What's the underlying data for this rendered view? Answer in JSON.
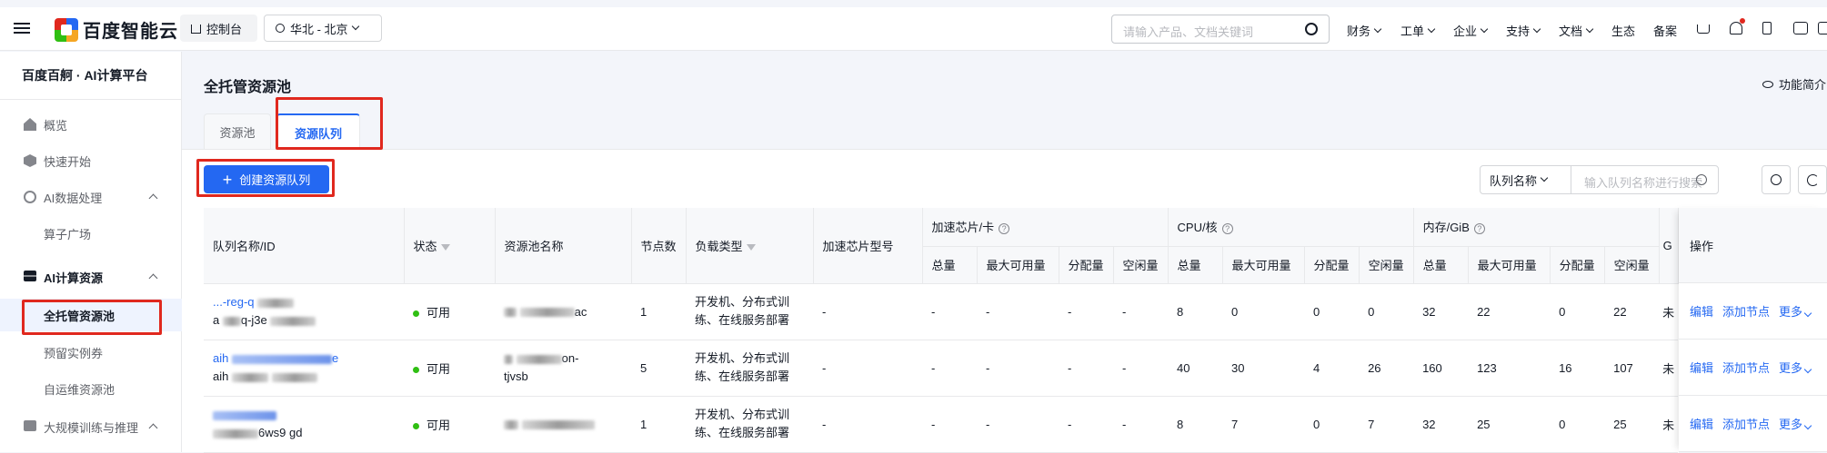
{
  "topbar": {
    "brand": "百度智能云",
    "console": "控制台",
    "region": "华北 - 北京",
    "search_placeholder": "请输入产品、文档关键词",
    "nav": [
      "财务",
      "工单",
      "企业",
      "支持",
      "文档",
      "生态",
      "备案"
    ]
  },
  "sidebar": {
    "title": "百度百舸 · AI计算平台",
    "items": [
      {
        "label": "概览"
      },
      {
        "label": "快速开始"
      },
      {
        "label": "AI数据处理"
      },
      {
        "label": "算子广场"
      },
      {
        "label": "AI计算资源"
      },
      {
        "label": "全托管资源池"
      },
      {
        "label": "预留实例券"
      },
      {
        "label": "自运维资源池"
      },
      {
        "label": "大规模训练与推理"
      }
    ]
  },
  "main": {
    "title": "全托管资源池",
    "intro": "功能简介",
    "tabs": [
      "资源池",
      "资源队列"
    ],
    "create_button": "创建资源队列",
    "filter_select": "队列名称",
    "filter_placeholder": "输入队列名称进行搜索"
  },
  "table": {
    "headers": {
      "name": "队列名称/ID",
      "status": "状态",
      "pool": "资源池名称",
      "nodes": "节点数",
      "load": "负载类型",
      "chip_model": "加速芯片型号",
      "chip_group": "加速芯片/卡",
      "cpu_group": "CPU/核",
      "mem_group": "内存/GiB",
      "cut": "G",
      "ops": "操作"
    },
    "sub_headers": [
      "总量",
      "最大可用量",
      "分配量",
      "空闲量"
    ],
    "rows": [
      {
        "name_a": "...-reg-q",
        "name_b": "a",
        "name_b2": "q-j3e",
        "status": "可用",
        "pool_a": "ac",
        "pool_b": "",
        "nodes": "1",
        "load": "开发机、分布式训练、在线服务部署",
        "chip_model": "-",
        "chip": [
          "-",
          "-",
          "-",
          "-"
        ],
        "cpu": [
          "8",
          "0",
          "0",
          "0"
        ],
        "mem": [
          "32",
          "22",
          "0",
          "22"
        ],
        "cut": "未"
      },
      {
        "name_a": "aih",
        "name_b": "aih",
        "name_b2": "",
        "status": "可用",
        "pool_a": "on-",
        "pool_b": "tjvsb",
        "nodes": "5",
        "load": "开发机、分布式训练、在线服务部署",
        "chip_model": "-",
        "chip": [
          "-",
          "-",
          "-",
          "-"
        ],
        "cpu": [
          "40",
          "30",
          "4",
          "26"
        ],
        "mem": [
          "160",
          "123",
          "16",
          "107"
        ],
        "cut": "未"
      },
      {
        "name_a": "",
        "name_b": "",
        "name_b2": "6ws9  gd",
        "status": "可用",
        "pool_a": "",
        "pool_b": "",
        "nodes": "1",
        "load": "开发机、分布式训练、在线服务部署",
        "chip_model": "-",
        "chip": [
          "-",
          "-",
          "-",
          "-"
        ],
        "cpu": [
          "8",
          "7",
          "0",
          "7"
        ],
        "mem": [
          "32",
          "25",
          "0",
          "25"
        ],
        "cut": "未"
      }
    ],
    "ops": [
      "编辑",
      "添加节点",
      "更多"
    ]
  }
}
